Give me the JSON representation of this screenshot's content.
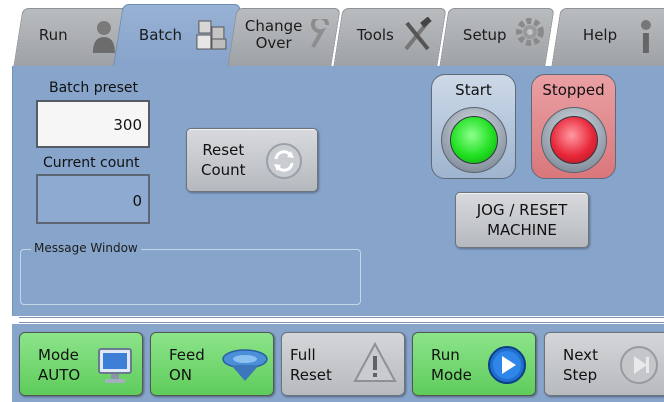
{
  "tabs": [
    {
      "label": "Run",
      "icon": "person-icon",
      "active": false
    },
    {
      "label": "Batch",
      "icon": "boxes-icon",
      "active": true
    },
    {
      "label_line1": "Change",
      "label_line2": "Over",
      "icon": "wrench-icon",
      "active": false
    },
    {
      "label": "Tools",
      "icon": "tools-icon",
      "active": false
    },
    {
      "label": "Setup",
      "icon": "gear-icon",
      "active": false
    },
    {
      "label": "Help",
      "icon": "info-icon",
      "active": false
    }
  ],
  "batch": {
    "preset_label": "Batch preset",
    "preset_value": "300",
    "count_label": "Current count",
    "count_value": "0",
    "reset_count_line1": "Reset",
    "reset_count_line2": "Count"
  },
  "message_window": {
    "label": "Message Window",
    "text": ""
  },
  "controls": {
    "start_label": "Start",
    "stopped_label": "Stopped",
    "jog_line1": "JOG / RESET",
    "jog_line2": "MACHINE"
  },
  "bottom": [
    {
      "line1": "Mode",
      "line2": "AUTO",
      "icon": "monitor-icon"
    },
    {
      "line1": "Feed",
      "line2": "ON",
      "icon": "feed-bowl-icon"
    },
    {
      "line1": "Full",
      "line2": "Reset",
      "icon": "warning-icon"
    },
    {
      "line1": "Run",
      "line2": "Mode",
      "icon": "play-icon"
    },
    {
      "line1": "Next",
      "line2": "Step",
      "icon": "next-step-icon"
    }
  ],
  "colors": {
    "panel": "#87a4cb",
    "start_lamp": "#22e022",
    "stop_lamp": "#e8283a",
    "function_green": "#6fd66c"
  }
}
